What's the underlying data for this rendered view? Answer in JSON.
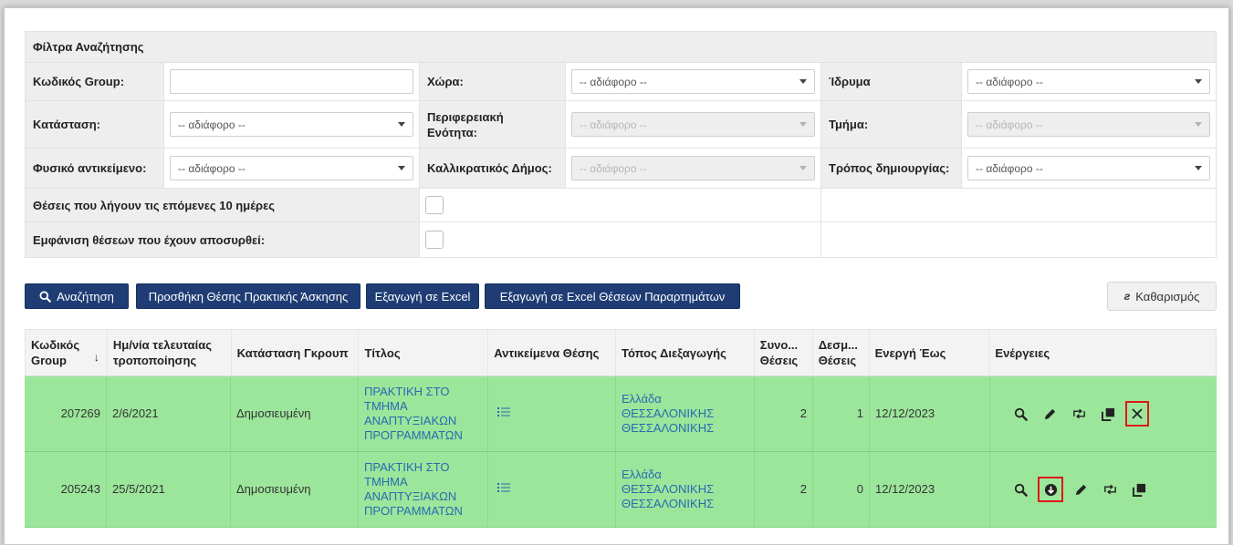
{
  "filters": {
    "title": "Φίλτρα Αναζήτησης",
    "group_code_label": "Κωδικός Group:",
    "group_code_value": "",
    "country_label": "Χώρα:",
    "country_value": "-- αδιάφορο --",
    "institution_label": "Ίδρυμα",
    "institution_value": "-- αδιάφορο --",
    "status_label": "Κατάσταση:",
    "status_value": "-- αδιάφορο --",
    "region_label": "Περιφερειακή Ενότητα:",
    "region_value": "-- αδιάφορο --",
    "department_label": "Τμήμα:",
    "department_value": "-- αδιάφορο --",
    "physical_object_label": "Φυσικό αντικείμενο:",
    "physical_object_value": "-- αδιάφορο --",
    "municipality_label": "Καλλικρατικός Δήμος:",
    "municipality_value": "-- αδιάφορο --",
    "creation_method_label": "Τρόπος δημιουργίας:",
    "creation_method_value": "-- αδιάφορο --",
    "expiring_label": "Θέσεις που λήγουν τις επόμενες 10 ημέρες",
    "withdrawn_label": "Εμφάνιση θέσεων που έχουν αποσυρθεί:"
  },
  "buttons": {
    "search": "Αναζήτηση",
    "add_position": "Προσθήκη Θέσης Πρακτικής Άσκησης",
    "export_excel": "Εξαγωγή σε Excel",
    "export_excel_branches": "Εξαγωγή σε Excel Θέσεων Παραρτημάτων",
    "clear": "Καθαρισμός"
  },
  "table": {
    "headers": {
      "group_code": "Κωδικός Group",
      "last_modified": "Ημ/νία τελευταίας τροποποίησης",
      "group_status": "Κατάσταση Γκρουπ",
      "title": "Τίτλος",
      "position_objects": "Αντικείμενα Θέσης",
      "location": "Τόπος Διεξαγωγής",
      "total_positions": "Συνο... Θέσεις",
      "bound_positions": "Δεσμ... Θέσεις",
      "active_until": "Ενεργή Έως",
      "actions": "Ενέργειες"
    },
    "rows": [
      {
        "group_code": "207269",
        "last_modified": "2/6/2021",
        "group_status": "Δημοσιευμένη",
        "title": "ΠΡΑΚΤΙΚΗ ΣΤΟ ΤΜΗΜΑ ΑΝΑΠΤΥΞΙΑΚΩΝ ΠΡΟΓΡΑΜΜΑΤΩΝ",
        "location": "Ελλάδα ΘΕΣΣΑΛΟΝΙΚΗΣ ΘΕΣΣΑΛΟΝΙΚΗΣ",
        "total_positions": "2",
        "bound_positions": "1",
        "active_until": "12/12/2023"
      },
      {
        "group_code": "205243",
        "last_modified": "25/5/2021",
        "group_status": "Δημοσιευμένη",
        "title": "ΠΡΑΚΤΙΚΗ ΣΤΟ ΤΜΗΜΑ ΑΝΑΠΤΥΞΙΑΚΩΝ ΠΡΟΓΡΑΜΜΑΤΩΝ",
        "location": "Ελλάδα ΘΕΣΣΑΛΟΝΙΚΗΣ ΘΕΣΣΑΛΟΝΙΚΗΣ",
        "total_positions": "2",
        "bound_positions": "0",
        "active_until": "12/12/2023"
      }
    ]
  },
  "colors": {
    "primary_button": "#1f3d74",
    "row_green": "#9be69b",
    "highlight_red": "#e01818",
    "link_blue": "#2a6ab1"
  }
}
